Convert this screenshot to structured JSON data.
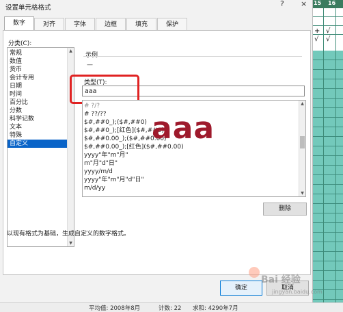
{
  "window": {
    "title": "设置单元格格式",
    "help_glyph": "?",
    "close_glyph": "×"
  },
  "tabs": [
    "数字",
    "对齐",
    "字体",
    "边框",
    "填充",
    "保护"
  ],
  "category": {
    "label": "分类(C):",
    "items": [
      "常规",
      "数值",
      "货币",
      "会计专用",
      "日期",
      "时间",
      "百分比",
      "分数",
      "科学记数",
      "文本",
      "特殊",
      "自定义"
    ],
    "selected_index": 11
  },
  "sample": {
    "label": "示例",
    "value": "—"
  },
  "type_field": {
    "label": "类型(T):",
    "value": "aaa"
  },
  "format_list": {
    "items": [
      "# ?/?",
      "# ??/??",
      "$#,##0_);($#,##0)",
      "$#,##0_);[红色]($#,##0)",
      "$#,##0.00_);($#,##0.00)",
      "$#,##0.00_);[红色]($#,##0.00)",
      "yyyy\"年\"m\"月\"",
      "m\"月\"d\"日\"",
      "yyyy/m/d",
      "yyyy\"年\"m\"月\"d\"日\"",
      "m/d/yy"
    ]
  },
  "overlay_text": "aaa",
  "buttons": {
    "delete": "删除",
    "ok": "确定",
    "cancel": "取消"
  },
  "description": "以现有格式为基础，生成自定义的数字格式。",
  "statusbar": {
    "average": "平均值: 2008年8月",
    "count": "计数: 22",
    "sum": "求和: 4290年7月"
  },
  "sheet": {
    "col_numbers": [
      "15",
      "16"
    ],
    "marks": [
      "√",
      "√",
      "+",
      "√"
    ]
  },
  "watermark": {
    "text": "Bai 经验",
    "url": "jingyan.baidu.com"
  },
  "colors": {
    "selection": "#0a64c8",
    "highlight_border": "#e02222",
    "overlay_text": "#9e1a2c",
    "sheet_teal": "#73c9bb"
  }
}
